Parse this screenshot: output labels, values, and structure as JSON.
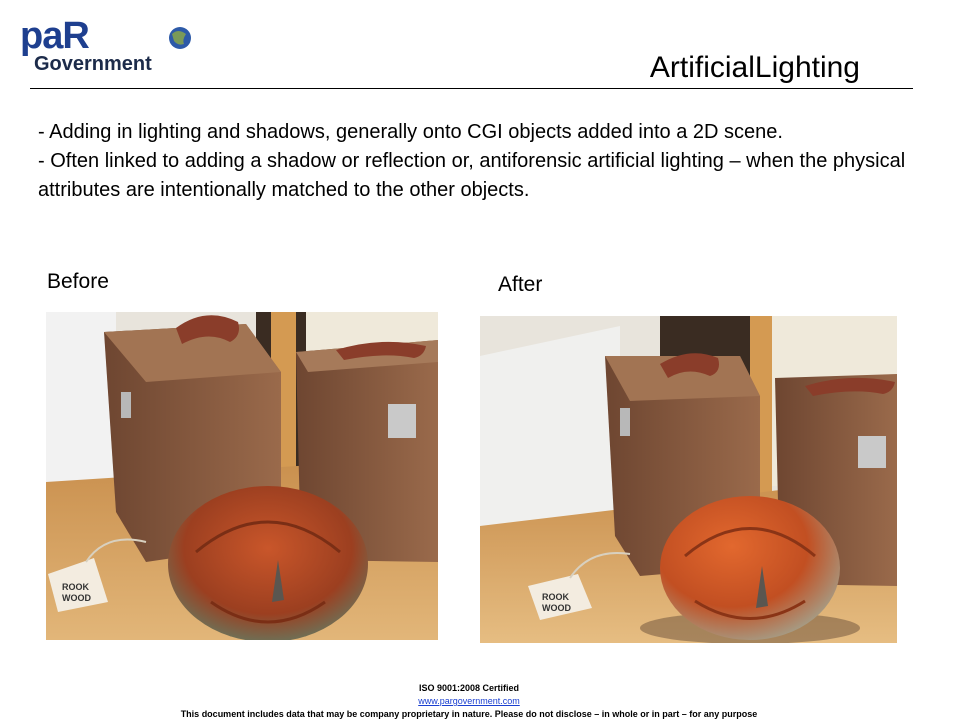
{
  "logo": {
    "brand_top": "paR",
    "brand_bottom": "Government"
  },
  "slide": {
    "title": "ArtificialLighting",
    "bullet_1": "- Adding in lighting and shadows, generally onto CGI objects added into a 2D scene.",
    "bullet_2": "-  Often linked to adding a shadow or reflection or, antiforensic artificial lighting – when the physical attributes are intentionally matched to the other objects.",
    "label_before": "Before",
    "label_after": "After"
  },
  "photos": {
    "tag_text_1": "ROOK",
    "tag_text_2": "WOOD"
  },
  "footer": {
    "certification": "ISO 9001:2008 Certified",
    "website": "www.pargovernment.com",
    "disclaimer": "This document includes data that may be company proprietary in nature. Please do not disclose – in whole or in part – for any purpose"
  },
  "colors": {
    "logo_blue": "#1e3f8f",
    "logo_dark": "#1c2b4a",
    "wood": "#d9a864",
    "case": "#8b5e41",
    "pumpkin": "#c24f22"
  }
}
